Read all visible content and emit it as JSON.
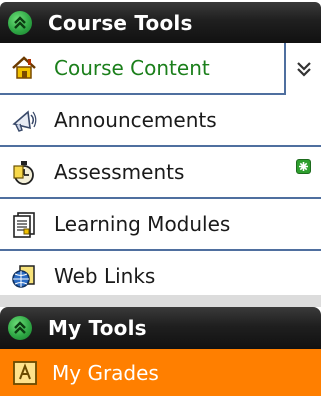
{
  "course_tools": {
    "title": "Course Tools",
    "items": [
      {
        "label": "Course Content",
        "icon": "home-icon"
      },
      {
        "label": "Announcements",
        "icon": "megaphone-icon"
      },
      {
        "label": "Assessments",
        "icon": "assessment-icon"
      },
      {
        "label": "Learning Modules",
        "icon": "document-icon"
      },
      {
        "label": "Web Links",
        "icon": "globe-link-icon"
      }
    ]
  },
  "my_tools": {
    "title": "My Tools",
    "items": [
      {
        "label": "My Grades",
        "icon": "grades-icon"
      }
    ]
  },
  "colors": {
    "header_bg": "#1f1f1f",
    "link_green": "#1b7f1b",
    "divider_blue": "#4f6f9f",
    "selected_orange": "#ff7f00"
  }
}
